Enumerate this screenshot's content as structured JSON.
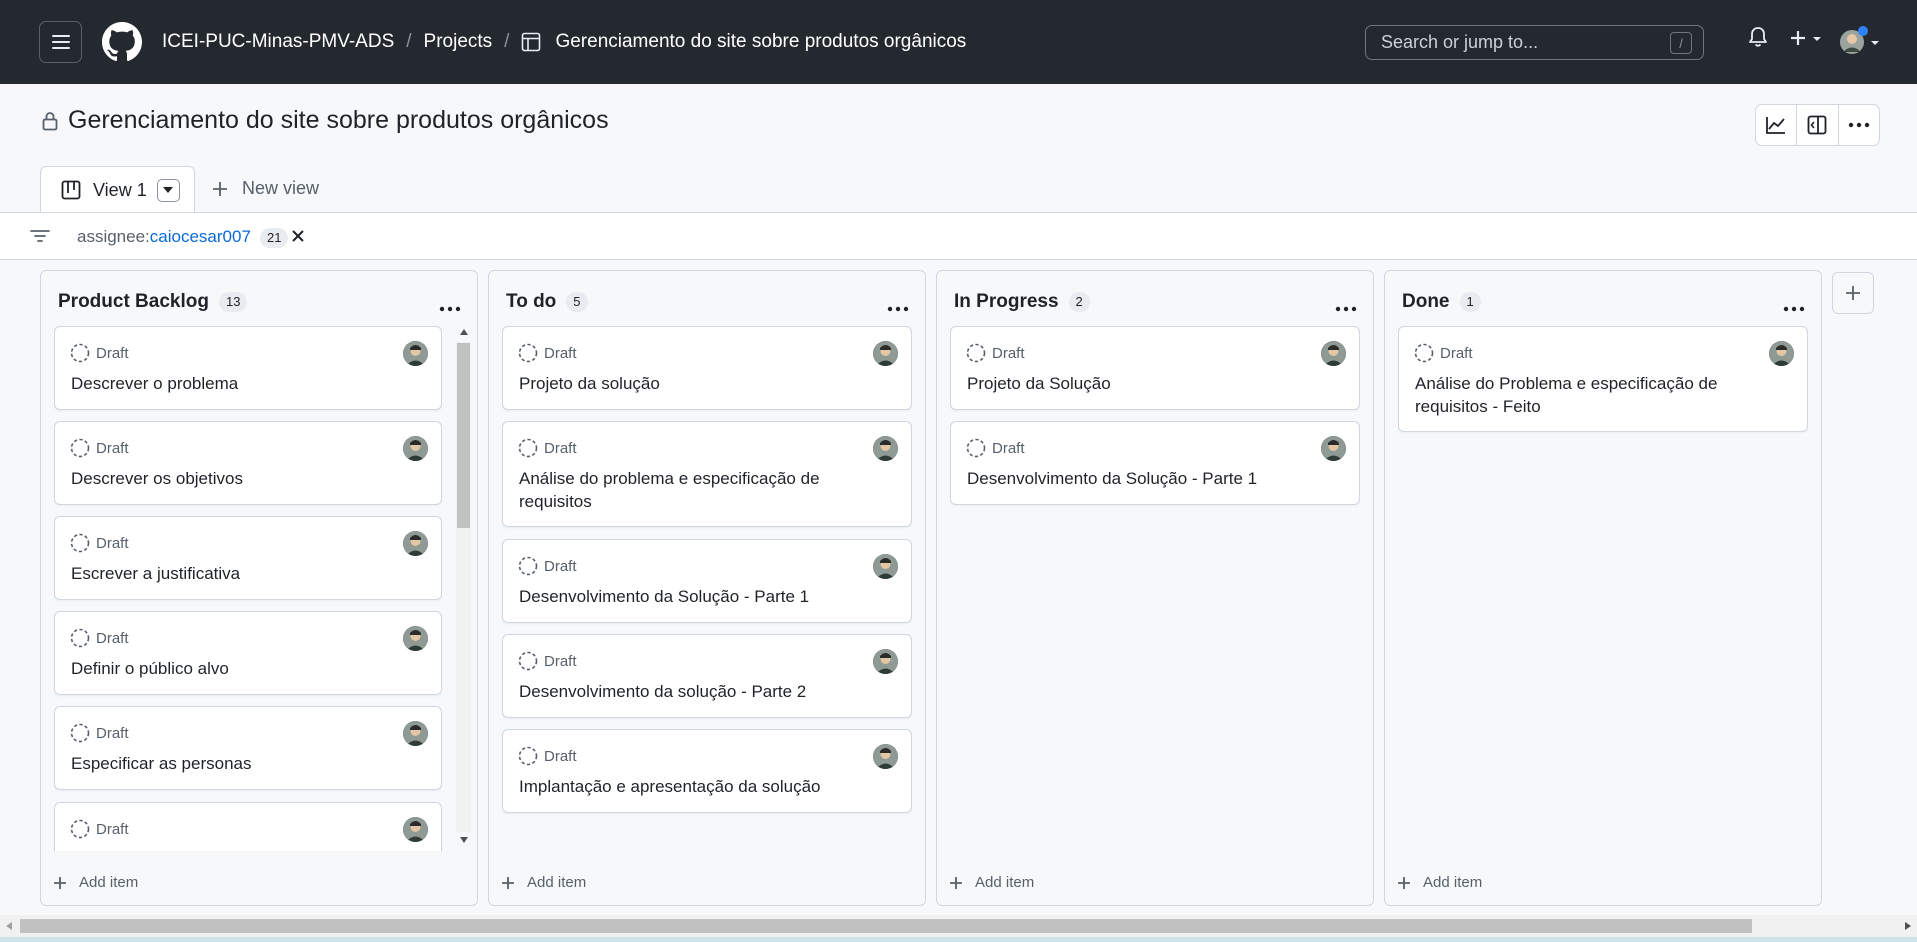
{
  "header": {
    "org": "ICEI-PUC-Minas-PMV-ADS",
    "projects": "Projects",
    "project_name": "Gerenciamento do site sobre produtos orgânicos",
    "search_placeholder": "Search or jump to...",
    "search_shortcut": "/"
  },
  "page": {
    "title": "Gerenciamento do site sobre produtos orgânicos"
  },
  "views": {
    "active_tab": "View 1",
    "new_view": "New view"
  },
  "filter": {
    "key": "assignee:",
    "value": "caiocesar007",
    "count": "21"
  },
  "columns": [
    {
      "name": "Product Backlog",
      "count": "13",
      "add_label": "Add item",
      "cards": [
        {
          "status": "Draft",
          "title": "Descrever o problema"
        },
        {
          "status": "Draft",
          "title": "Descrever os objetivos"
        },
        {
          "status": "Draft",
          "title": "Escrever a justificativa"
        },
        {
          "status": "Draft",
          "title": "Definir o público alvo"
        },
        {
          "status": "Draft",
          "title": "Especificar as personas"
        },
        {
          "status": "Draft",
          "title": ""
        }
      ]
    },
    {
      "name": "To do",
      "count": "5",
      "add_label": "Add item",
      "cards": [
        {
          "status": "Draft",
          "title": "Projeto da solução"
        },
        {
          "status": "Draft",
          "title": "Análise do problema e especificação de requisitos"
        },
        {
          "status": "Draft",
          "title": "Desenvolvimento da Solução - Parte 1"
        },
        {
          "status": "Draft",
          "title": "Desenvolvimento da solução - Parte 2"
        },
        {
          "status": "Draft",
          "title": "Implantação e apresentação da solução"
        }
      ]
    },
    {
      "name": "In Progress",
      "count": "2",
      "add_label": "Add item",
      "cards": [
        {
          "status": "Draft",
          "title": "Projeto da Solução"
        },
        {
          "status": "Draft",
          "title": "Desenvolvimento da Solução - Parte 1"
        }
      ]
    },
    {
      "name": "Done",
      "count": "1",
      "add_label": "Add item",
      "cards": [
        {
          "status": "Draft",
          "title": "Análise do Problema e especificação de requisitos - Feito"
        }
      ]
    }
  ],
  "colors": {
    "header_bg": "#24292f",
    "link": "#0969da",
    "notification_dot": "#2f81f7"
  }
}
